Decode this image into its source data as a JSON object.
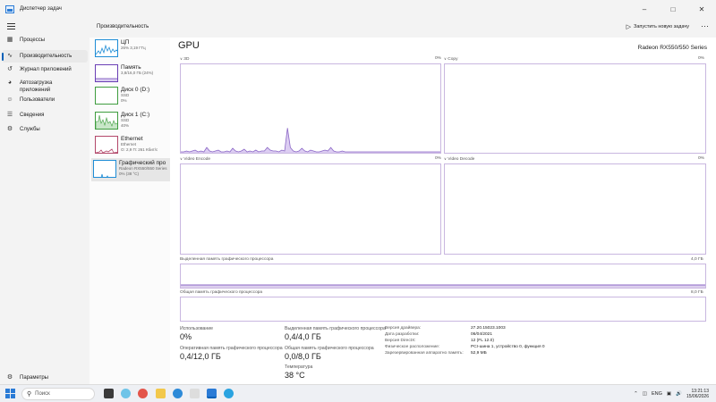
{
  "window": {
    "title": "Диспетчер задач"
  },
  "nav": {
    "items": [
      {
        "label": "Процессы",
        "icon": "grid-icon"
      },
      {
        "label": "Производительность",
        "icon": "pulse-icon",
        "active": true
      },
      {
        "label": "Журнал приложений",
        "icon": "history-icon"
      },
      {
        "label": "Автозагрузка приложений",
        "icon": "speedometer-icon"
      },
      {
        "label": "Пользователи",
        "icon": "users-icon"
      },
      {
        "label": "Сведения",
        "icon": "list-icon"
      },
      {
        "label": "Службы",
        "icon": "gear-icon"
      }
    ],
    "settings_label": "Параметры"
  },
  "header": {
    "title": "Производительность",
    "run_task_label": "Запустить новую задачу",
    "more_label": "···"
  },
  "resources": [
    {
      "name": "ЦП",
      "sub1": "26%  3,19 ГГц",
      "sub2": "",
      "color": "#1f8dd6"
    },
    {
      "name": "Память",
      "sub1": "3,8/16,0 ГБ (24%)",
      "sub2": "",
      "color": "#6a3fb5"
    },
    {
      "name": "Диск 0 (D:)",
      "sub1": "SSD",
      "sub2": "0%",
      "color": "#3f9d3f"
    },
    {
      "name": "Диск 1 (C:)",
      "sub1": "SSD",
      "sub2": "40%",
      "color": "#3f9d3f"
    },
    {
      "name": "Ethernet",
      "sub1": "Ethernet",
      "sub2": "О: 2,9  П: 261 Кбит/с",
      "color": "#b3486a"
    },
    {
      "name": "Графический про",
      "sub1": "Radeon RX550/550 Series",
      "sub2": "0% (38 °C)",
      "color": "#1f8dd6",
      "active": true
    }
  ],
  "gpu": {
    "title": "GPU",
    "model": "Radeon RX550/550 Series",
    "engines": [
      {
        "name": "3D",
        "percent": "0%"
      },
      {
        "name": "Copy",
        "percent": "0%"
      },
      {
        "name": "Video Encode",
        "percent": "0%"
      },
      {
        "name": "Video Decode",
        "percent": "0%"
      }
    ],
    "dedicated_label": "Выделенная память графического процессора",
    "dedicated_max": "4,0 ГБ",
    "shared_label": "Общая память графического процессора",
    "shared_max": "8,0 ГБ"
  },
  "stats": {
    "utilization_label": "Использование",
    "utilization_value": "0%",
    "gpu_mem_label": "Оперативная память графического процессора",
    "gpu_mem_value": "0,4/12,0 ГБ",
    "dedicated_label": "Выделенная память графического процессора",
    "dedicated_value": "0,4/4,0 ГБ",
    "shared_label": "Общая память графического процессора",
    "shared_value": "0,0/8,0 ГБ",
    "temp_label": "Температура",
    "temp_value": "38 °C"
  },
  "props": [
    {
      "key": "Версия драйвера:",
      "value": "27.20.15023.1003"
    },
    {
      "key": "Дата разработки:",
      "value": "06/04/2021"
    },
    {
      "key": "Версия DirectX:",
      "value": "12 (FL 12.0)"
    },
    {
      "key": "Физическое расположение:",
      "value": "PCI-шина 1, устройство 0, функция 0"
    },
    {
      "key": "Зарезервированная аппаратно память:",
      "value": "52,9 МБ"
    }
  ],
  "taskbar": {
    "search_placeholder": "Поиск",
    "lang": "ENG",
    "time": "13:21:13",
    "date": "15/06/2026"
  },
  "chart_data": {
    "type": "area",
    "title": "3D",
    "ylim": [
      0,
      100
    ],
    "series": [
      {
        "values": [
          1,
          1,
          2,
          1,
          2,
          3,
          1,
          2,
          1,
          6,
          2,
          1,
          2,
          3,
          1,
          1,
          2,
          1,
          5,
          2,
          1,
          2,
          4,
          1,
          2,
          1,
          3,
          1,
          2,
          2,
          6,
          3,
          2,
          2,
          1,
          3,
          2,
          28,
          6,
          2,
          1,
          2,
          5,
          2,
          1,
          3,
          2,
          1,
          1,
          2,
          3,
          2,
          6,
          2,
          1,
          1,
          2,
          1,
          1,
          1,
          1,
          1,
          1,
          1,
          1,
          1,
          1,
          1,
          1,
          1,
          1,
          1,
          1,
          1,
          1,
          1,
          1,
          1,
          1,
          1,
          1,
          1,
          1,
          1,
          1,
          1,
          1,
          1,
          1,
          1,
          1
        ]
      }
    ]
  }
}
